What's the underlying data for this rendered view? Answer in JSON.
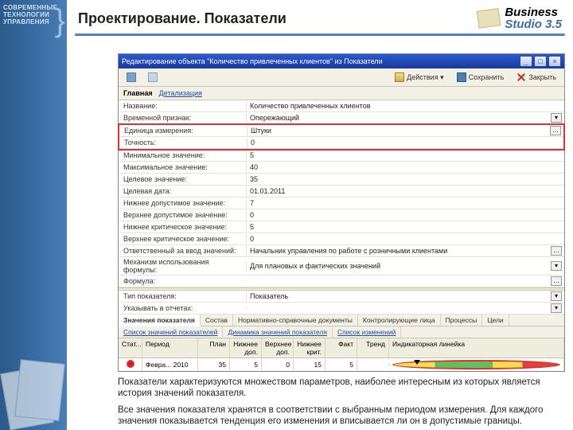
{
  "brand_left": {
    "l1": "СОВРЕМЕННЫЕ",
    "l2": "ТЕХНОЛОГИИ",
    "l3": "УПРАВЛЕНИЯ"
  },
  "slide_title": "Проектирование. Показатели",
  "bs_logo": {
    "line1": "Business",
    "line2": "Studio 3.5"
  },
  "window": {
    "title": "Редактирование объекта \"Количество привлеченных клиентов\" из Показатели",
    "toolbar": {
      "actions": "Действия ▾",
      "save": "Сохранить",
      "close": "Закрыть"
    },
    "tabs": {
      "main": "Главная",
      "detail": "Детализация"
    },
    "fields": [
      {
        "label": "Название:",
        "value": "Количество привлеченных клиентов"
      },
      {
        "label": "Временной признак:",
        "value": "Опережающий"
      },
      {
        "label": "Единица измерения:",
        "value": "Штуки"
      },
      {
        "label": "Точность:",
        "value": "0"
      },
      {
        "label": "Минимальное значение:",
        "value": "5"
      },
      {
        "label": "Максимальное значение:",
        "value": "40"
      },
      {
        "label": "Целевое значение:",
        "value": "35"
      },
      {
        "label": "Целевая дата:",
        "value": "01.01.2011"
      },
      {
        "label": "Нижнее допустимое значение:",
        "value": "7"
      },
      {
        "label": "Верхнее допустимое значение:",
        "value": "0"
      },
      {
        "label": "Нижнее критическое значение:",
        "value": "5"
      },
      {
        "label": "Верхнее критическое значение:",
        "value": "0"
      },
      {
        "label": "Ответственный за ввод значений:",
        "value": "Начальник управления по работе с розничными клиентами"
      },
      {
        "label": "Механизм использования формулы:",
        "value": "Для плановых и фактических значений"
      },
      {
        "label": "Формула:",
        "value": ""
      }
    ],
    "fields2": [
      {
        "label": "Тип показателя:",
        "value": "Показатель"
      },
      {
        "label": "Указывать в отчетах:",
        "value": ""
      }
    ],
    "subtabs": [
      "Значения показателя",
      "Состав",
      "Нормативно-справочные документы",
      "Контролирующие лица",
      "Процессы",
      "Цели"
    ],
    "subtabs2": [
      "Список значений показателей",
      "Динамика значений показателя",
      "Список изменений"
    ],
    "grid": {
      "headers": [
        "Стат...",
        "Период",
        "План",
        "Нижнее доп.",
        "Верхнее доп.",
        "Нижнее крит.",
        "Факт",
        "Тренд",
        "Индикаторная линейка"
      ],
      "row": {
        "period": "Февра... 2010",
        "plan": "35",
        "ldop": "5",
        "udop": "0",
        "lcrit": "15",
        "fact": "5",
        "trend": ""
      }
    }
  },
  "caption": {
    "p1": "Показатели характеризуются множеством параметров, наиболее интересным из которых является история значений показателя.",
    "p2": "Все значения показателя хранятся в соответствии с выбранным периодом измерения. Для каждого значения показывается тенденция его изменения и вписывается ли он в допустимые границы."
  }
}
